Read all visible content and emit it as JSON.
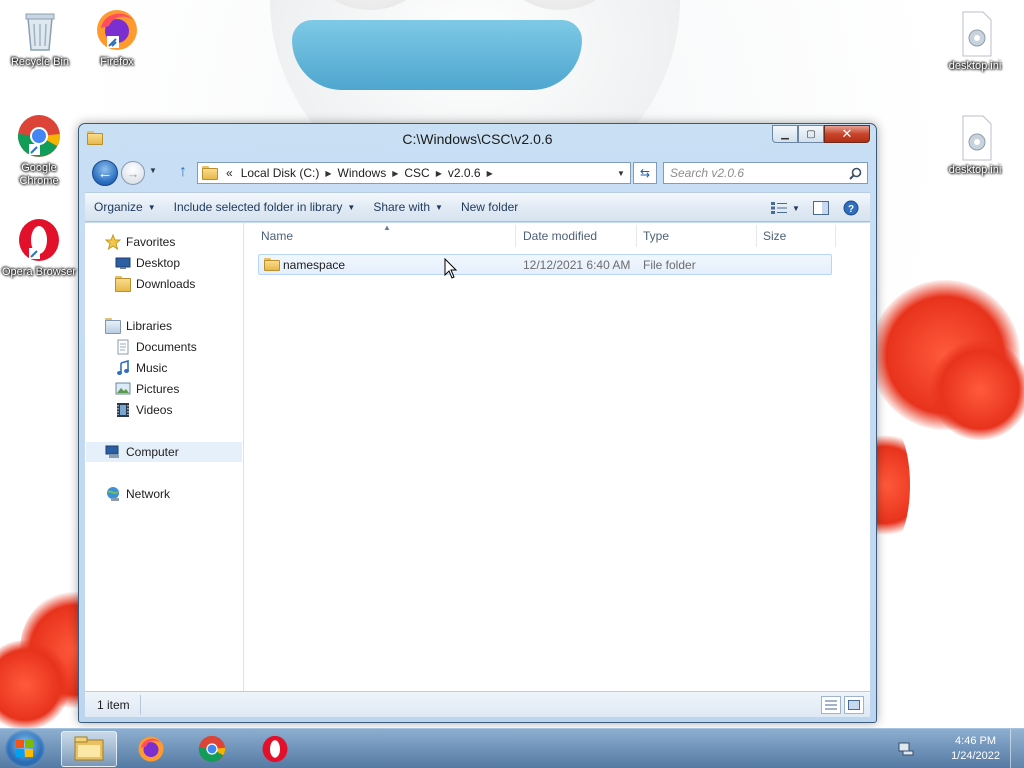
{
  "desktop": {
    "icons_left": [
      {
        "name": "recycle-bin",
        "label": "Recycle Bin"
      },
      {
        "name": "firefox",
        "label": "Firefox"
      },
      {
        "name": "google-chrome",
        "label": "Google Chrome"
      },
      {
        "name": "opera-browser",
        "label": "Opera Browser"
      }
    ],
    "icons_right": [
      {
        "name": "desktop-ini-1",
        "label": "desktop.ini"
      },
      {
        "name": "desktop-ini-2",
        "label": "desktop.ini"
      }
    ]
  },
  "window": {
    "title": "C:\\Windows\\CSC\\v2.0.6",
    "address": {
      "overflow": "«",
      "crumbs": [
        "Local Disk (C:)",
        "Windows",
        "CSC",
        "v2.0.6"
      ]
    },
    "search": {
      "placeholder": "Search v2.0.6"
    },
    "commands": {
      "organize": "Organize",
      "include": "Include selected folder in library",
      "share": "Share with",
      "new_folder": "New folder"
    },
    "nav": {
      "favorites": "Favorites",
      "desktop": "Desktop",
      "downloads": "Downloads",
      "libraries": "Libraries",
      "documents": "Documents",
      "music": "Music",
      "pictures": "Pictures",
      "videos": "Videos",
      "computer": "Computer",
      "network": "Network"
    },
    "columns": {
      "name": "Name",
      "date": "Date modified",
      "type": "Type",
      "size": "Size"
    },
    "files": [
      {
        "name": "namespace",
        "date": "12/12/2021 6:40 AM",
        "type": "File folder",
        "size": ""
      }
    ],
    "status": {
      "count": "1 item"
    }
  },
  "taskbar": {
    "items": [
      "windows-explorer",
      "firefox",
      "google-chrome",
      "opera"
    ],
    "clock": {
      "time": "4:46 PM",
      "date": "1/24/2022"
    }
  },
  "colors": {
    "accent": "#2b6fc1",
    "taskbar": "#5a86b4",
    "selection": "#e5f0fb"
  }
}
